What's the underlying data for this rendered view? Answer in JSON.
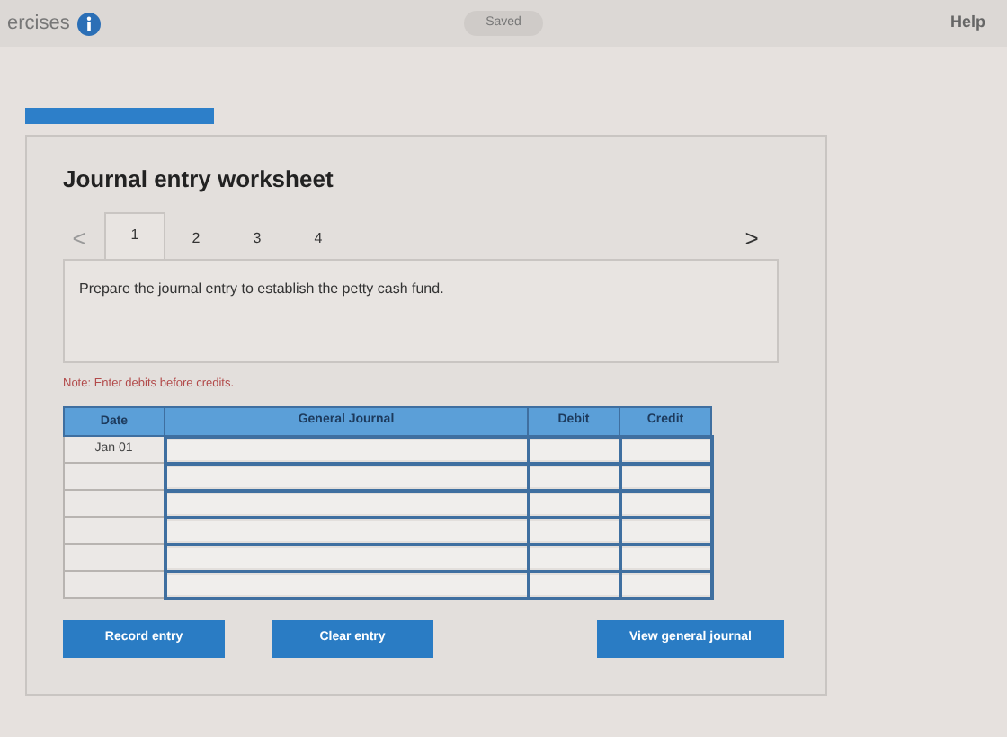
{
  "top_bar": {
    "title": "ercises",
    "status": "Saved",
    "help": "Help"
  },
  "worksheet": {
    "title": "Journal entry worksheet",
    "tabs": [
      {
        "label": "1",
        "selected": true
      },
      {
        "label": "2",
        "selected": false
      },
      {
        "label": "3",
        "selected": false
      },
      {
        "label": "4",
        "selected": false
      }
    ],
    "prev": "<",
    "next": ">",
    "question": "Prepare the journal entry to establish the petty cash fund.",
    "note": "Note: Enter debits before credits.",
    "table": {
      "columns": [
        "Date",
        "General Journal",
        "Debit",
        "Credit"
      ],
      "rows": [
        {
          "date": "Jan 01"
        },
        {},
        {},
        {},
        {},
        {}
      ]
    },
    "buttons": [
      "Record entry",
      "Clear entry",
      "View general journal"
    ]
  }
}
